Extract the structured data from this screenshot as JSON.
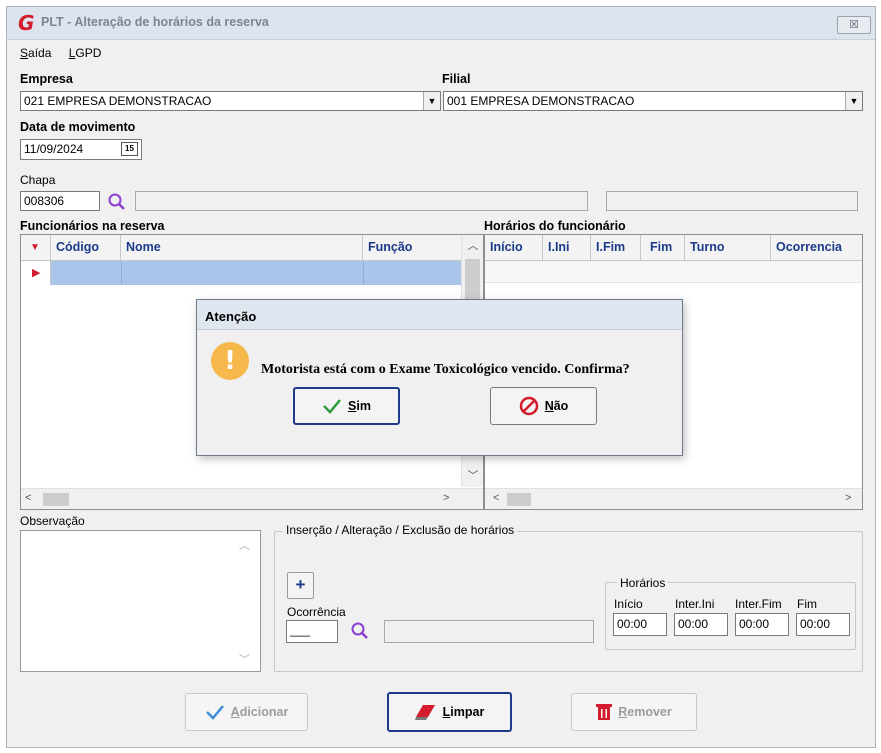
{
  "window": {
    "title": "PLT - Alteração de horários da reserva",
    "logo": "G",
    "close_glyph": "☒"
  },
  "menu": [
    {
      "label": "Saída",
      "accel": "S"
    },
    {
      "label": "LGPD",
      "accel": "L"
    }
  ],
  "empresa": {
    "label": "Empresa",
    "value": "021 EMPRESA DEMONSTRACAO"
  },
  "filial": {
    "label": "Filial",
    "value": "001 EMPRESA DEMONSTRACAO"
  },
  "data_movimento": {
    "label": "Data de movimento",
    "value": "11/09/2024",
    "calendar_glyph": "15"
  },
  "chapa": {
    "label": "Chapa",
    "value": "008306",
    "name_value": "",
    "extra_value": ""
  },
  "funcionarios": {
    "label": "Funcionários na reserva",
    "columns": [
      "Código",
      "Nome",
      "Função"
    ]
  },
  "horarios_func": {
    "label": "Horários do funcionário",
    "columns": [
      "Início",
      "I.Ini",
      "I.Fim",
      "Fim",
      "Turno",
      "Ocorrencia"
    ]
  },
  "observacao": {
    "label": "Observação",
    "value": ""
  },
  "insercao": {
    "title": "Inserção / Alteração / Exclusão de horários",
    "add_glyph": "+",
    "ocorrencia_label": "Ocorrência",
    "ocorrencia_value": "___",
    "ocorrencia_desc": "",
    "horarios_title": "Horários",
    "fields": [
      {
        "label": "Início",
        "value": "00:00"
      },
      {
        "label": "Inter.Ini",
        "value": "00:00"
      },
      {
        "label": "Inter.Fim",
        "value": "00:00"
      },
      {
        "label": "Fim",
        "value": "00:00"
      }
    ]
  },
  "buttons": {
    "adicionar": {
      "accel": "A",
      "rest": "dicionar"
    },
    "limpar": {
      "accel": "L",
      "rest": "impar"
    },
    "remover": {
      "accel": "R",
      "rest": "emover"
    }
  },
  "dialog": {
    "title": "Atenção",
    "icon_glyph": "!",
    "message": "Motorista está com o Exame Toxicológico vencido. Confirma?",
    "sim": {
      "accel": "S",
      "rest": "im"
    },
    "nao": {
      "accel": "N",
      "rest": "ão"
    }
  },
  "colors": {
    "accent_blue": "#1c3a8a",
    "warning": "#f6b84a",
    "danger": "#d31c2c",
    "selected_row": "#aac4ea",
    "ok_green": "#2e9e3e"
  }
}
